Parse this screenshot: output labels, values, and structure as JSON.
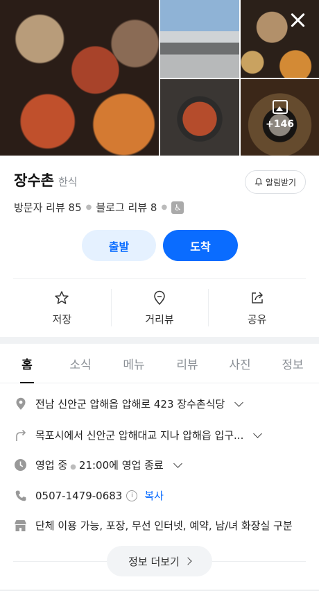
{
  "gallery": {
    "photo_count_label": "+146"
  },
  "place": {
    "name": "장수촌",
    "category": "한식",
    "notify_label": "알림받기",
    "visitor_reviews": "방문자 리뷰 85",
    "blog_reviews": "블로그 리뷰 8"
  },
  "route": {
    "start_label": "출발",
    "end_label": "도착"
  },
  "actions": {
    "save_label": "저장",
    "street_view_label": "거리뷰",
    "share_label": "공유"
  },
  "tabs": [
    {
      "label": "홈"
    },
    {
      "label": "소식"
    },
    {
      "label": "메뉴"
    },
    {
      "label": "리뷰"
    },
    {
      "label": "사진"
    },
    {
      "label": "정보"
    }
  ],
  "info": {
    "address": "전남 신안군 압해읍 압해로 423 장수촌식당",
    "directions": "목포시에서 신안군 압해대교 지나 압해읍 입구...",
    "status": "영업 중",
    "hours": "21:00에 영업 종료",
    "phone": "0507-1479-0683",
    "copy_label": "복사",
    "amenities": "단체 이용 가능, 포장, 무선 인터넷, 예약, 남/녀 화장실 구분"
  },
  "more_info_label": "정보 더보기",
  "colors": {
    "accent": "#0a6cff",
    "accent_light": "#e5f1ff"
  }
}
